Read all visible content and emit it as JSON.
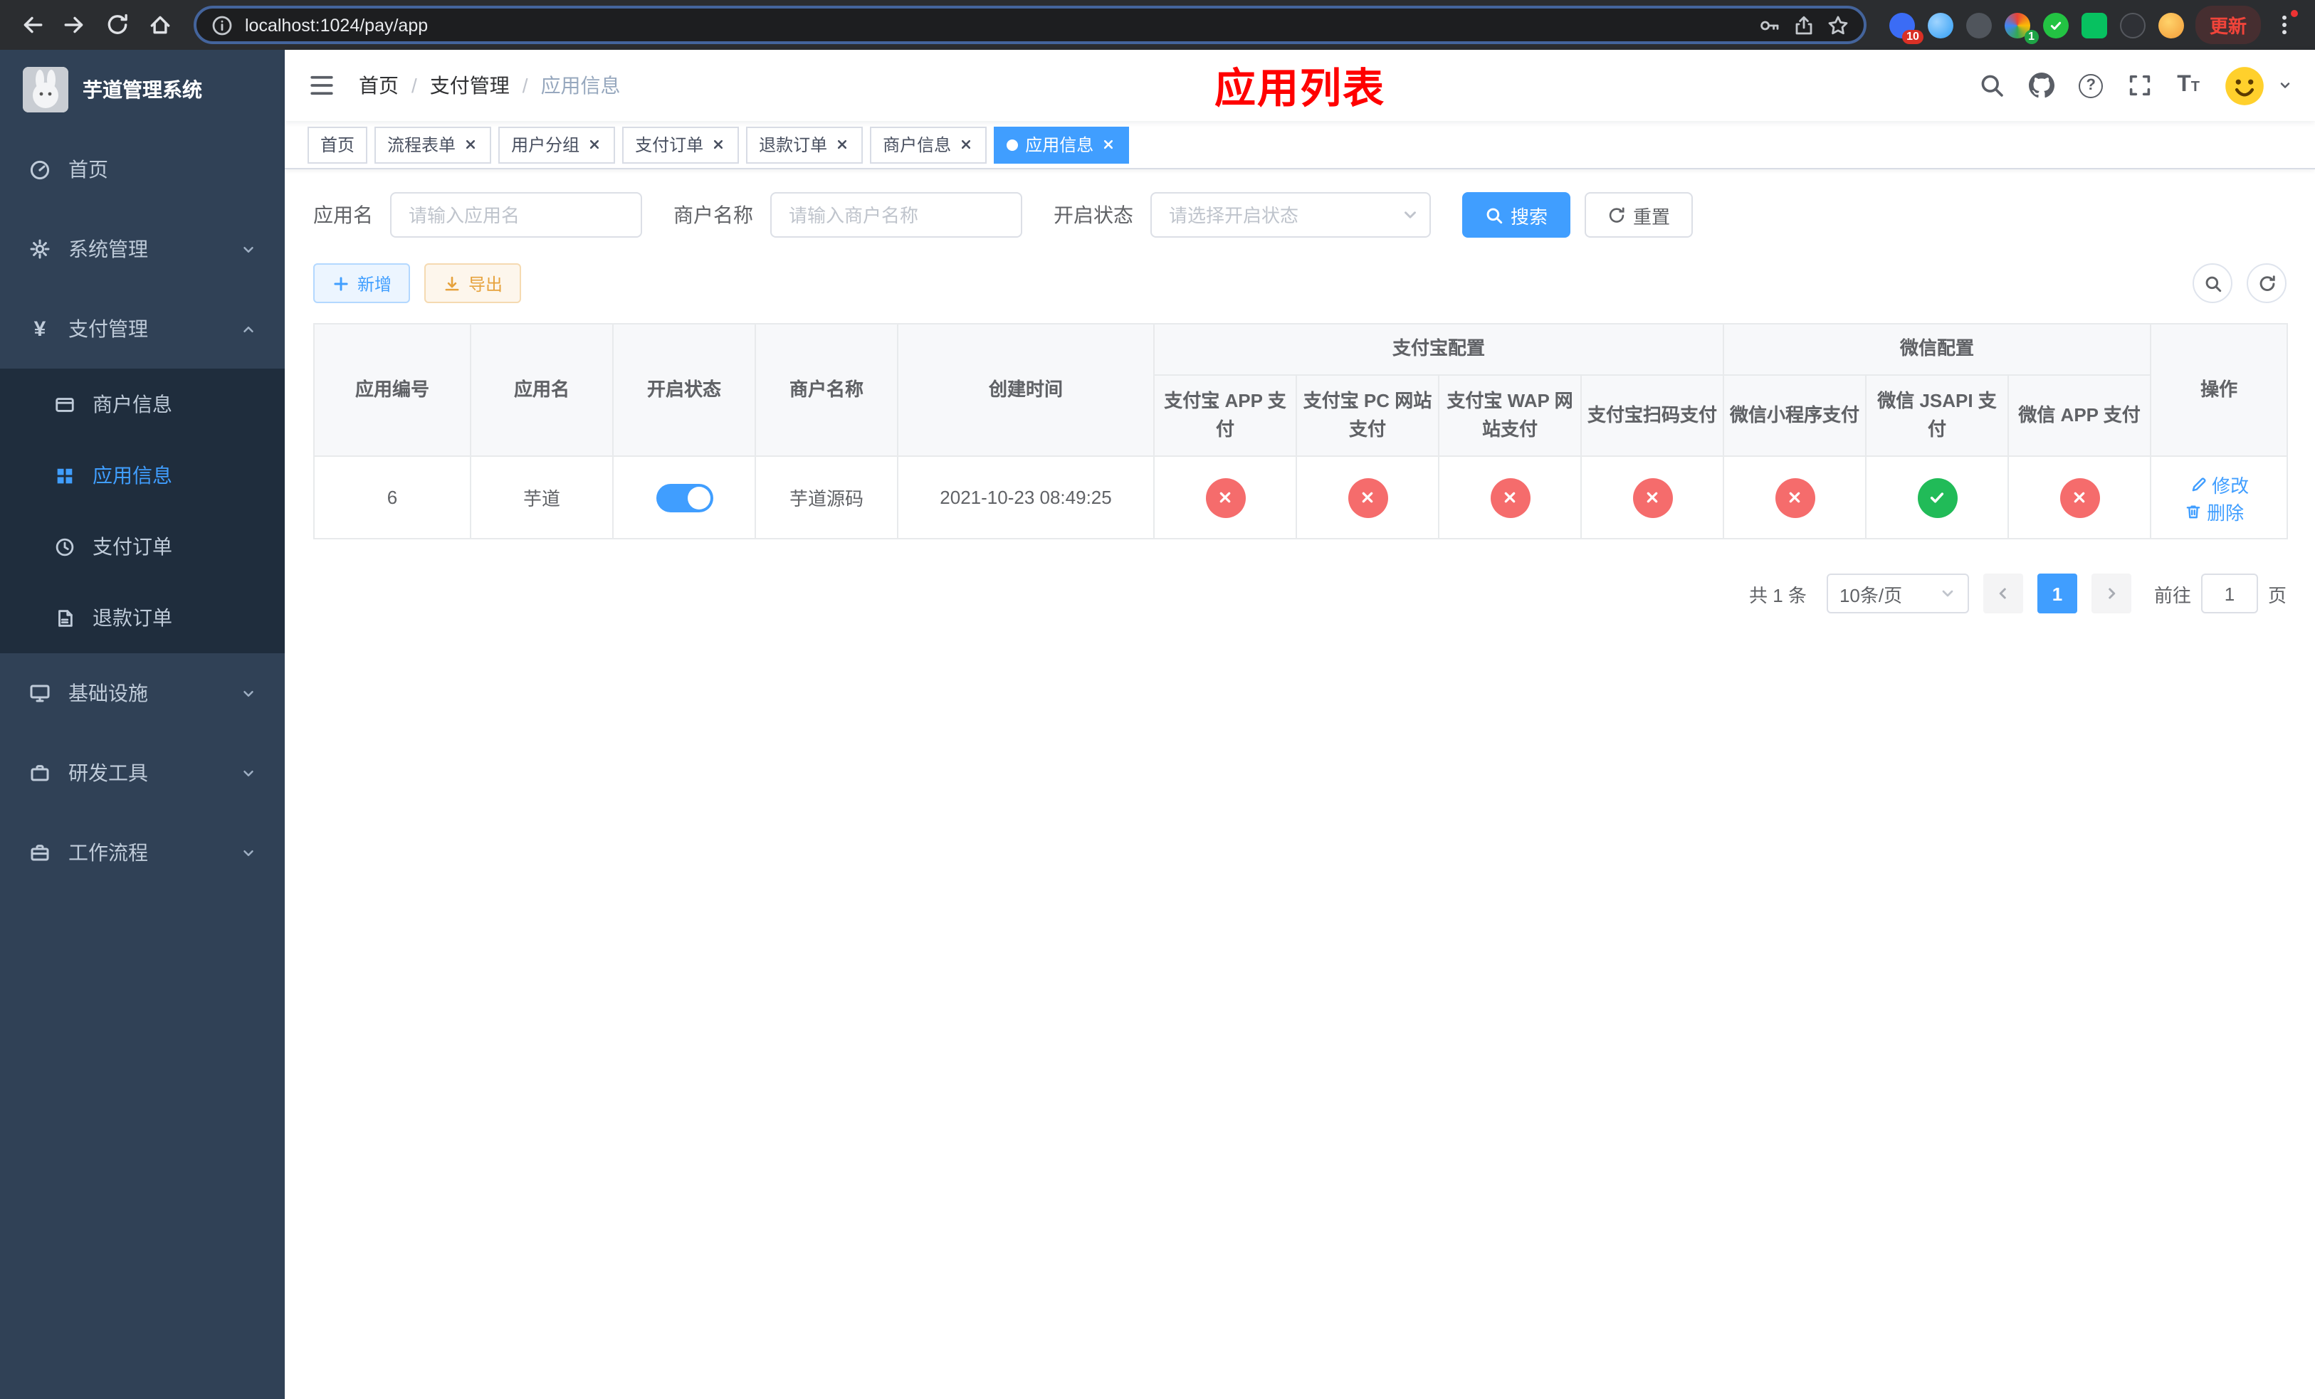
{
  "browser": {
    "url": "localhost:1024/pay/app",
    "update_label": "更新",
    "ext_badge_ten": "10",
    "ext_badge_one": "1"
  },
  "glyphs": {
    "yuan": "¥",
    "question": "?",
    "font_size": "T"
  },
  "sidebar": {
    "logo_title": "芋道管理系统",
    "items": [
      {
        "label": "首页"
      },
      {
        "label": "系统管理"
      },
      {
        "label": "支付管理"
      },
      {
        "label": "基础设施"
      },
      {
        "label": "研发工具"
      },
      {
        "label": "工作流程"
      }
    ],
    "payment_children": [
      {
        "label": "商户信息"
      },
      {
        "label": "应用信息"
      },
      {
        "label": "支付订单"
      },
      {
        "label": "退款订单"
      }
    ]
  },
  "header": {
    "breadcrumb": {
      "home": "首页",
      "section": "支付管理",
      "current": "应用信息",
      "separator": "/"
    },
    "page_title": "应用列表"
  },
  "tabs": [
    {
      "label": "首页"
    },
    {
      "label": "流程表单"
    },
    {
      "label": "用户分组"
    },
    {
      "label": "支付订单"
    },
    {
      "label": "退款订单"
    },
    {
      "label": "商户信息"
    },
    {
      "label": "应用信息"
    }
  ],
  "filters": {
    "app_name_label": "应用名",
    "app_name_placeholder": "请输入应用名",
    "merchant_label": "商户名称",
    "merchant_placeholder": "请输入商户名称",
    "status_label": "开启状态",
    "status_placeholder": "请选择开启状态",
    "search_label": "搜索",
    "reset_label": "重置"
  },
  "toolbar": {
    "add_label": "新增",
    "export_label": "导出"
  },
  "table": {
    "groups": {
      "alipay": "支付宝配置",
      "wechat": "微信配置"
    },
    "columns": {
      "id": "应用编号",
      "name": "应用名",
      "status": "开启状态",
      "merchant": "商户名称",
      "created": "创建时间",
      "alipay_app": "支付宝 APP 支付",
      "alipay_pc": "支付宝 PC 网站支付",
      "alipay_wap": "支付宝 WAP 网站支付",
      "alipay_qr": "支付宝扫码支付",
      "wx_lite": "微信小程序支付",
      "wx_jsapi": "微信 JSAPI 支付",
      "wx_app": "微信 APP 支付",
      "ops": "操作"
    },
    "row": {
      "id": "6",
      "name": "芋道",
      "merchant": "芋道源码",
      "created": "2021-10-23 08:49:25",
      "status_on": true,
      "alipay_app": "disabled",
      "alipay_pc": "disabled",
      "alipay_wap": "disabled",
      "alipay_qr": "disabled",
      "wx_lite": "disabled",
      "wx_jsapi": "enabled",
      "wx_app": "disabled",
      "edit_label": "修改",
      "delete_label": "删除"
    }
  },
  "pagination": {
    "total": "共 1 条",
    "page_size": "10条/页",
    "page": "1",
    "goto_label": "前往",
    "goto_value": "1",
    "unit_label": "页"
  },
  "colors": {
    "accent": "#409EFF",
    "sidebar_bg": "#304156",
    "submenu_bg": "#1f2d3d",
    "danger": "#f56c6c",
    "success": "#21bb58",
    "warning": "#e6a23c",
    "title_red": "#ff0000"
  }
}
